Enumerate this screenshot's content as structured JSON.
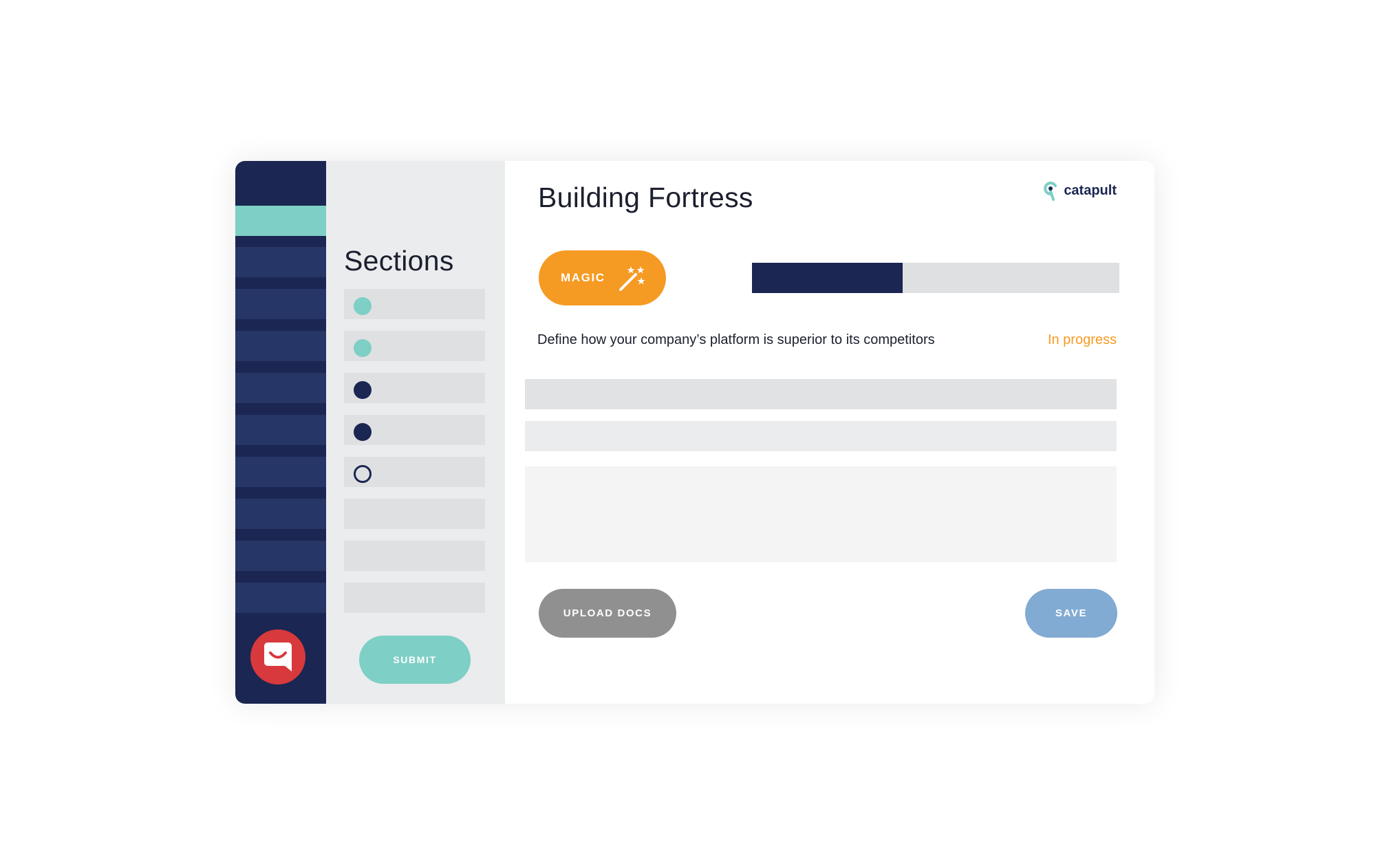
{
  "sidebar": {
    "accent_color": "#7ecfc6",
    "chat_icon": "chat-bubble-smile-icon"
  },
  "sections": {
    "title": "Sections",
    "rows": [
      {
        "status": "complete"
      },
      {
        "status": "complete"
      },
      {
        "status": "filled"
      },
      {
        "status": "filled"
      },
      {
        "status": "empty"
      },
      {
        "status": "none"
      },
      {
        "status": "none"
      },
      {
        "status": "none"
      }
    ],
    "submit_label": "SUBMIT"
  },
  "main": {
    "title": "Building Fortress",
    "logo_text": "catapult",
    "magic_label": "MAGIC",
    "magic_icon": "magic-wand-icon",
    "progress": 0.41,
    "question": "Define how your company’s platform is superior to its competitors",
    "status": "In progress",
    "upload_label": "UPLOAD DOCS",
    "save_label": "SAVE"
  },
  "colors": {
    "navy": "#1b2652",
    "teal": "#7ecfc6",
    "orange": "#f59a23",
    "red": "#d8393c",
    "save_blue": "#82abd3"
  }
}
